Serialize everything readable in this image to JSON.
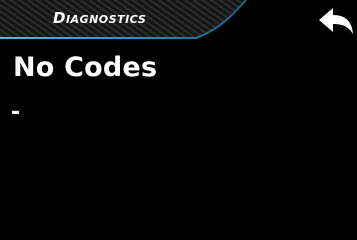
{
  "header": {
    "title": "Diagnostics",
    "back_icon": "back-arrow-icon",
    "accent_color": "#2f8fb8"
  },
  "main": {
    "heading": "No Codes",
    "detail": "-"
  }
}
